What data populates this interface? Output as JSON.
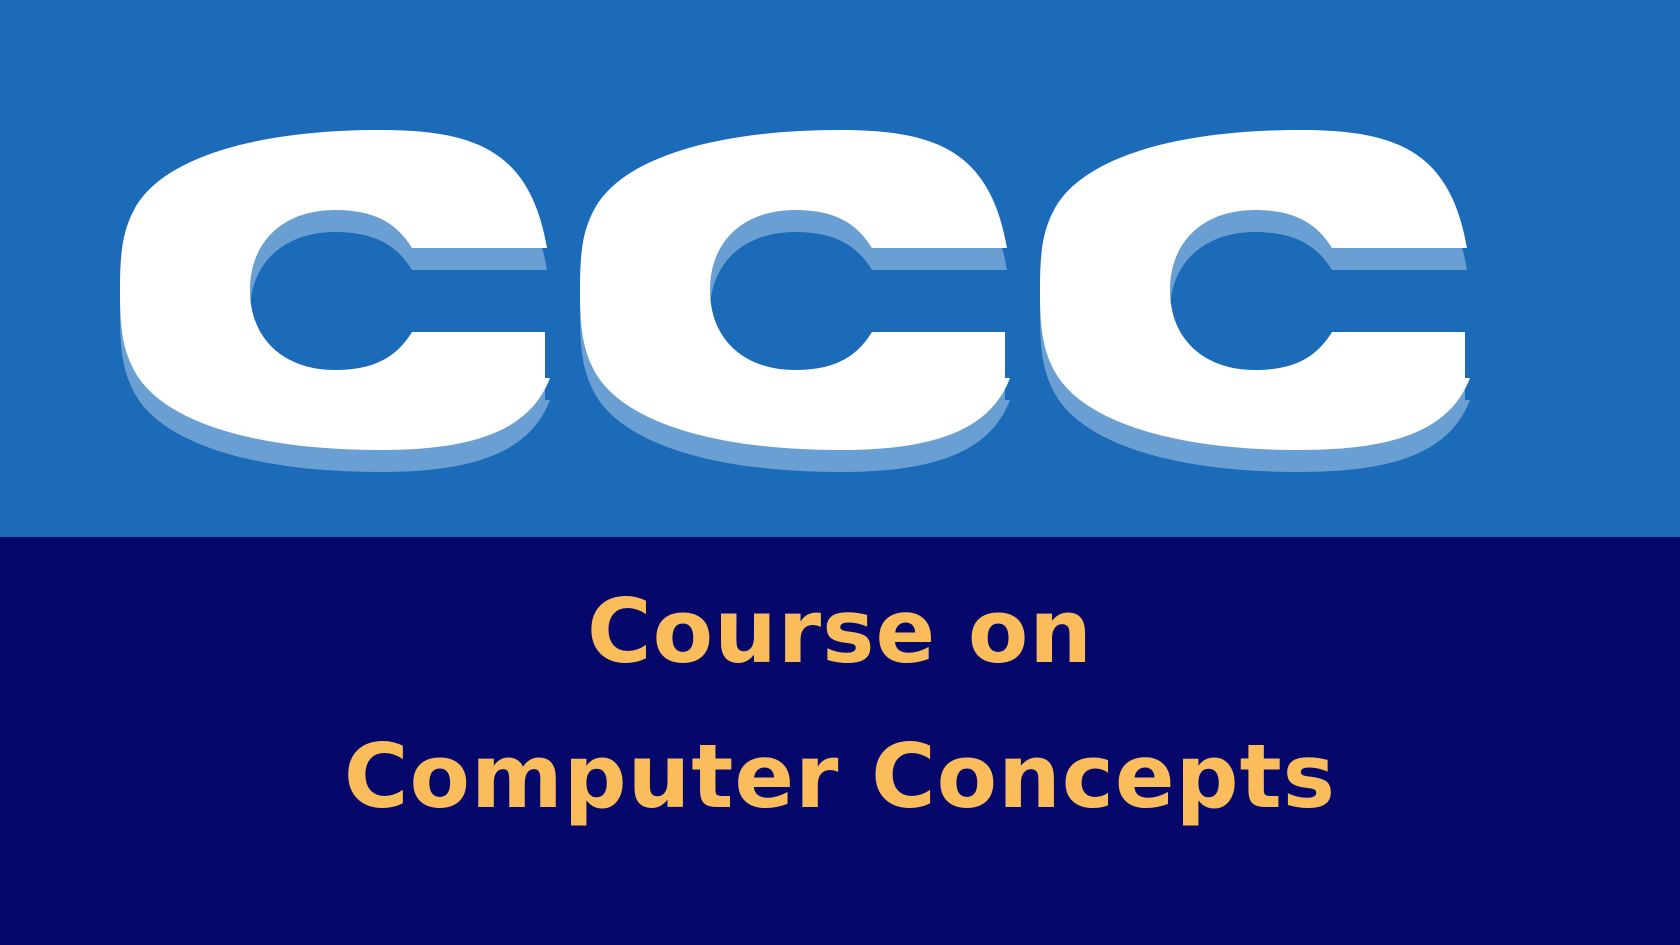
{
  "logo": {
    "letters": [
      "C",
      "C",
      "C"
    ],
    "fill_color": "#ffffff",
    "shadow_color": "#6a9fd3"
  },
  "subtitle": {
    "line1": "Course on",
    "line2": "Computer Concepts"
  },
  "colors": {
    "top_band": "#1b6bb8",
    "bottom_band": "#05076b",
    "subtitle_text": "#fbbd5c"
  }
}
